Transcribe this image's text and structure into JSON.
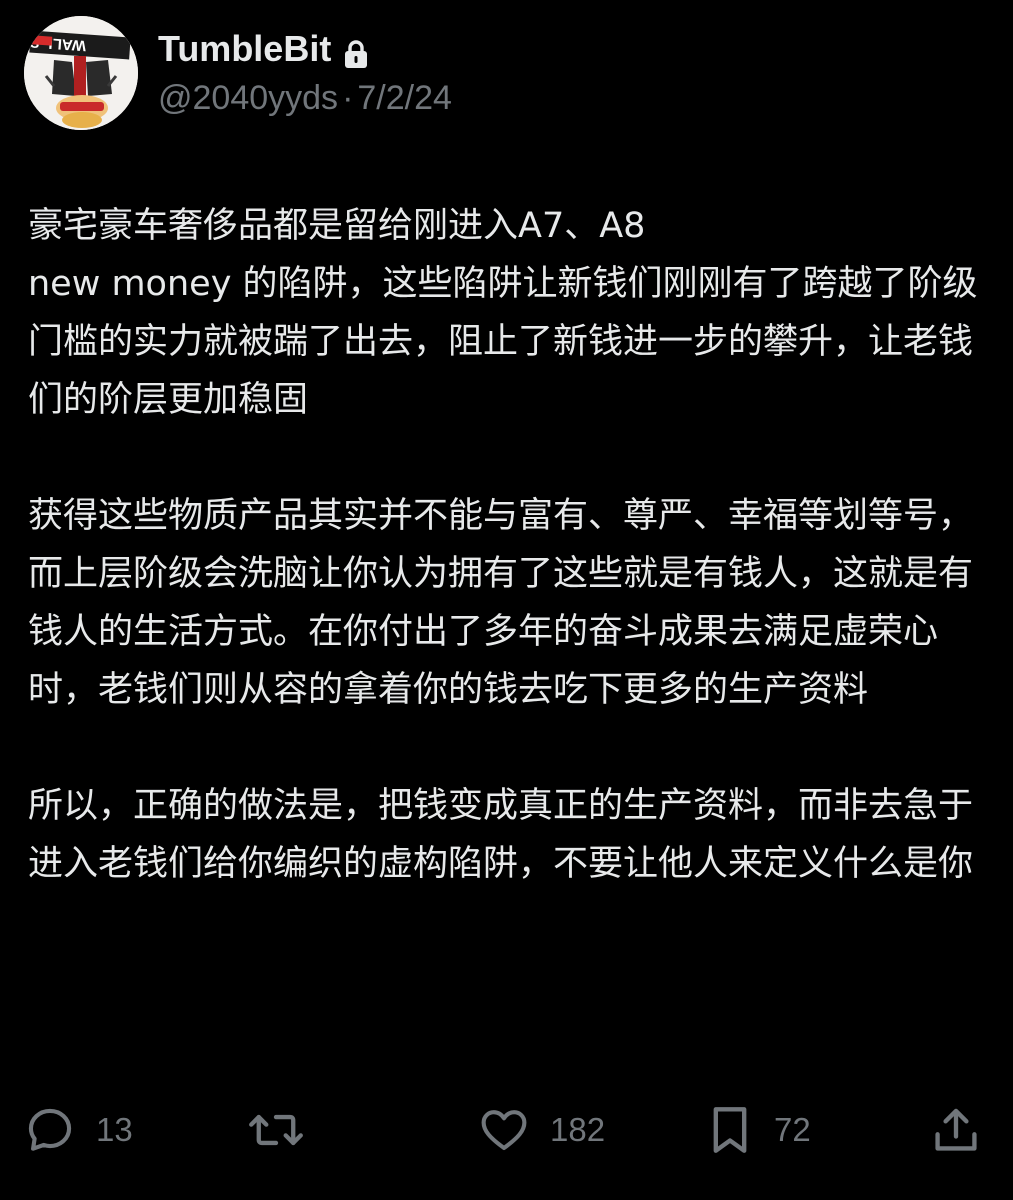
{
  "author": {
    "display_name": "TumbleBit",
    "handle": "@2040yyds",
    "separator": "·",
    "date": "7/2/24",
    "avatar_sign_text": "WALL ST",
    "lock_icon": "lock-icon"
  },
  "tweet": {
    "paragraphs": [
      "豪宅豪车奢侈品都是留给刚进入A7、A8\n new money 的陷阱，这些陷阱让新钱们刚刚有了跨越了阶级门槛的实力就被踹了出去，阻止了新钱进一步的攀升，让老钱们的阶层更加稳固",
      "获得这些物质产品其实并不能与富有、尊严、幸福等划等号，而上层阶级会洗脑让你认为拥有了这些就是有钱人，这就是有钱人的生活方式。在你付出了多年的奋斗成果去满足虚荣心时，老钱们则从容的拿着你的钱去吃下更多的生产资料",
      "所以，正确的做法是，把钱变成真正的生产资料，而非去急于进入老钱们给你编织的虚构陷阱，不要让他人来定义什么是你"
    ]
  },
  "actions": {
    "reply": {
      "icon": "reply-icon",
      "count": "13"
    },
    "retweet": {
      "icon": "retweet-icon",
      "count": ""
    },
    "like": {
      "icon": "heart-icon",
      "count": "182"
    },
    "bookmark": {
      "icon": "bookmark-icon",
      "count": "72"
    },
    "share": {
      "icon": "share-icon"
    }
  },
  "colors": {
    "background": "#000000",
    "primary_text": "#e7e9ea",
    "secondary_text": "#71767b",
    "avatar_bg": "#f3f1ee"
  }
}
